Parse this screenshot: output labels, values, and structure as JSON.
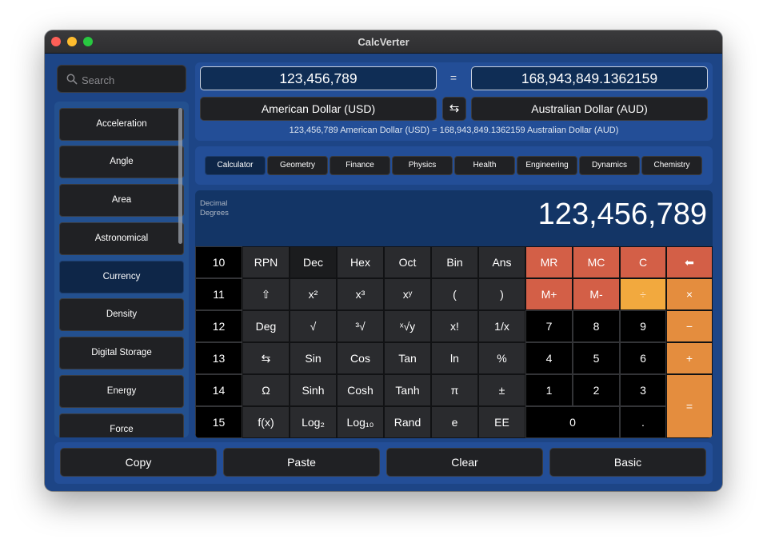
{
  "window": {
    "title": "CalcVerter"
  },
  "search": {
    "placeholder": "Search"
  },
  "sidebar": {
    "items": [
      {
        "label": "Acceleration"
      },
      {
        "label": "Angle"
      },
      {
        "label": "Area"
      },
      {
        "label": "Astronomical"
      },
      {
        "label": "Currency",
        "selected": true
      },
      {
        "label": "Density"
      },
      {
        "label": "Digital Storage"
      },
      {
        "label": "Energy"
      },
      {
        "label": "Force"
      }
    ]
  },
  "converter": {
    "input_value": "123,456,789",
    "equals": "=",
    "output_value": "168,943,849.1362159",
    "from_unit": "American Dollar (USD)",
    "swap_symbol": "⇆",
    "to_unit": "Australian Dollar (AUD)",
    "summary": "123,456,789 American Dollar (USD) = 168,943,849.1362159 Australian Dollar (AUD)"
  },
  "categories": [
    "Calculator",
    "Geometry",
    "Finance",
    "Physics",
    "Health",
    "Engineering",
    "Dynamics",
    "Chemistry"
  ],
  "display": {
    "mode_line1": "Decimal",
    "mode_line2": "Degrees",
    "value": "123,456,789"
  },
  "keypad": {
    "rows": [
      [
        "10",
        "RPN",
        "Dec",
        "Hex",
        "Oct",
        "Bin",
        "Ans",
        "MR",
        "MC",
        "C",
        "⬅"
      ],
      [
        "11",
        "⇧",
        "x²",
        "x³",
        "xʸ",
        "(",
        ")",
        "M+",
        "M-",
        "÷",
        "×"
      ],
      [
        "12",
        "Deg",
        "√",
        "³√",
        "ˣ√y",
        "x!",
        "1/x",
        "7",
        "8",
        "9",
        "−"
      ],
      [
        "13",
        "⇆",
        "Sin",
        "Cos",
        "Tan",
        "ln",
        "%",
        "4",
        "5",
        "6",
        "+"
      ],
      [
        "14",
        "Ω",
        "Sinh",
        "Cosh",
        "Tanh",
        "π",
        "±",
        "1",
        "2",
        "3",
        "="
      ],
      [
        "15",
        "f(x)",
        "Log₂",
        "Log₁₀",
        "Rand",
        "e",
        "EE",
        "0",
        "."
      ]
    ],
    "colors": {
      "memory": "#d35f47",
      "operator": "#e48d3e",
      "operator_selected": "#f2a93e",
      "function": "#2a2b2e",
      "number": "#000000"
    }
  },
  "bottom": {
    "copy": "Copy",
    "paste": "Paste",
    "clear": "Clear",
    "basic": "Basic"
  },
  "icons": {
    "search": "search-icon",
    "swap": "swap-icon",
    "backspace": "backspace-icon",
    "shift": "shift-icon"
  }
}
